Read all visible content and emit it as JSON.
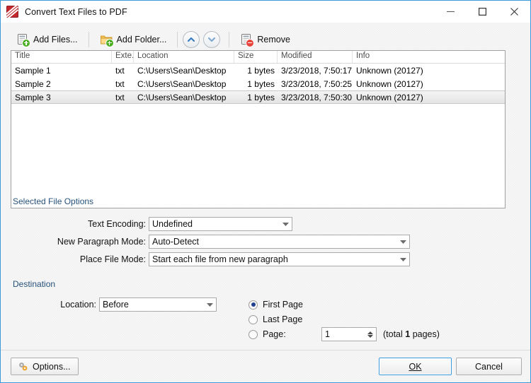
{
  "window": {
    "title": "Convert Text Files to PDF",
    "app_icon": "pdfxchange-icon",
    "controls": {
      "minimize": "minimize-icon",
      "maximize": "maximize-icon",
      "close": "close-icon"
    }
  },
  "toolbar": {
    "add_files": "Add Files...",
    "add_folder": "Add Folder...",
    "move_up": "move-up-icon",
    "move_down": "move-down-icon",
    "remove": "Remove"
  },
  "file_list": {
    "columns": [
      "Title",
      "Exte..",
      "Location",
      "Size",
      "Modified",
      "Info"
    ],
    "rows": [
      {
        "title": "Sample 1",
        "extension": "txt",
        "location": "C:\\Users\\Sean\\Desktop",
        "size": "1 bytes",
        "modified": "3/23/2018, 7:50:17 ..",
        "info": "Unknown (20127)",
        "selected": false
      },
      {
        "title": "Sample 2",
        "extension": "txt",
        "location": "C:\\Users\\Sean\\Desktop",
        "size": "1 bytes",
        "modified": "3/23/2018, 7:50:25 ..",
        "info": "Unknown (20127)",
        "selected": false
      },
      {
        "title": "Sample 3",
        "extension": "txt",
        "location": "C:\\Users\\Sean\\Desktop",
        "size": "1 bytes",
        "modified": "3/23/2018, 7:50:30 ..",
        "info": "Unknown (20127)",
        "selected": true
      }
    ]
  },
  "selected_file_options": {
    "group_label": "Selected File Options",
    "text_encoding": {
      "label": "Text Encoding:",
      "value": "Undefined"
    },
    "new_paragraph_mode": {
      "label": "New Paragraph Mode:",
      "value": "Auto-Detect"
    },
    "place_file_mode": {
      "label": "Place File Mode:",
      "value": "Start each file from new paragraph"
    }
  },
  "destination": {
    "group_label": "Destination",
    "location": {
      "label": "Location:",
      "value": "Before"
    },
    "radios": [
      {
        "label": "First Page",
        "selected": true
      },
      {
        "label": "Last Page",
        "selected": false
      },
      {
        "label": "Page:",
        "selected": false
      }
    ],
    "page_number": "1",
    "total_prefix": "(total ",
    "total_count": "1",
    "total_suffix": " pages)"
  },
  "footer": {
    "options": "Options...",
    "ok": "OK",
    "cancel": "Cancel"
  },
  "colors": {
    "window_border": "#3d99d8",
    "accent_blue": "#27527a",
    "radio_dot": "#1f3f8f",
    "icon_red": "#c1272d",
    "badge_green": "#4caf22",
    "badge_red": "#e8453c"
  }
}
